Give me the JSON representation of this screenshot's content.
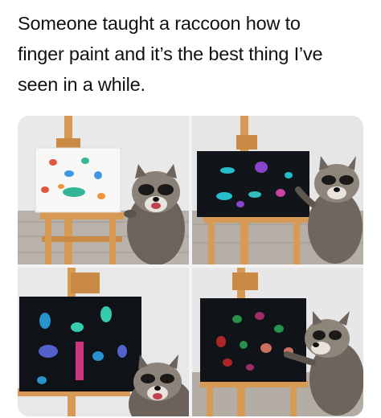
{
  "caption": {
    "lines": [
      "Someone taught a raccoon how to",
      "finger paint and it’s the best thing I’ve",
      "seen in a while."
    ],
    "color": "#111111"
  },
  "photos": [
    {
      "canvas_color": "#f7f7f5",
      "paint_colors": [
        "#e0452a",
        "#2a8fe0",
        "#1fb08c",
        "#f08a2a"
      ]
    },
    {
      "canvas_color": "#111418",
      "paint_colors": [
        "#2ad0e0",
        "#9a4ae0",
        "#e04ab0",
        "#3ad0d0"
      ]
    },
    {
      "canvas_color": "#0f1216",
      "paint_colors": [
        "#2aa0e0",
        "#e03a8a",
        "#3ae0c0",
        "#5a6ae0"
      ]
    },
    {
      "canvas_color": "#101418",
      "paint_colors": [
        "#c0282a",
        "#2aa050",
        "#e07a6a",
        "#b03070"
      ]
    }
  ]
}
